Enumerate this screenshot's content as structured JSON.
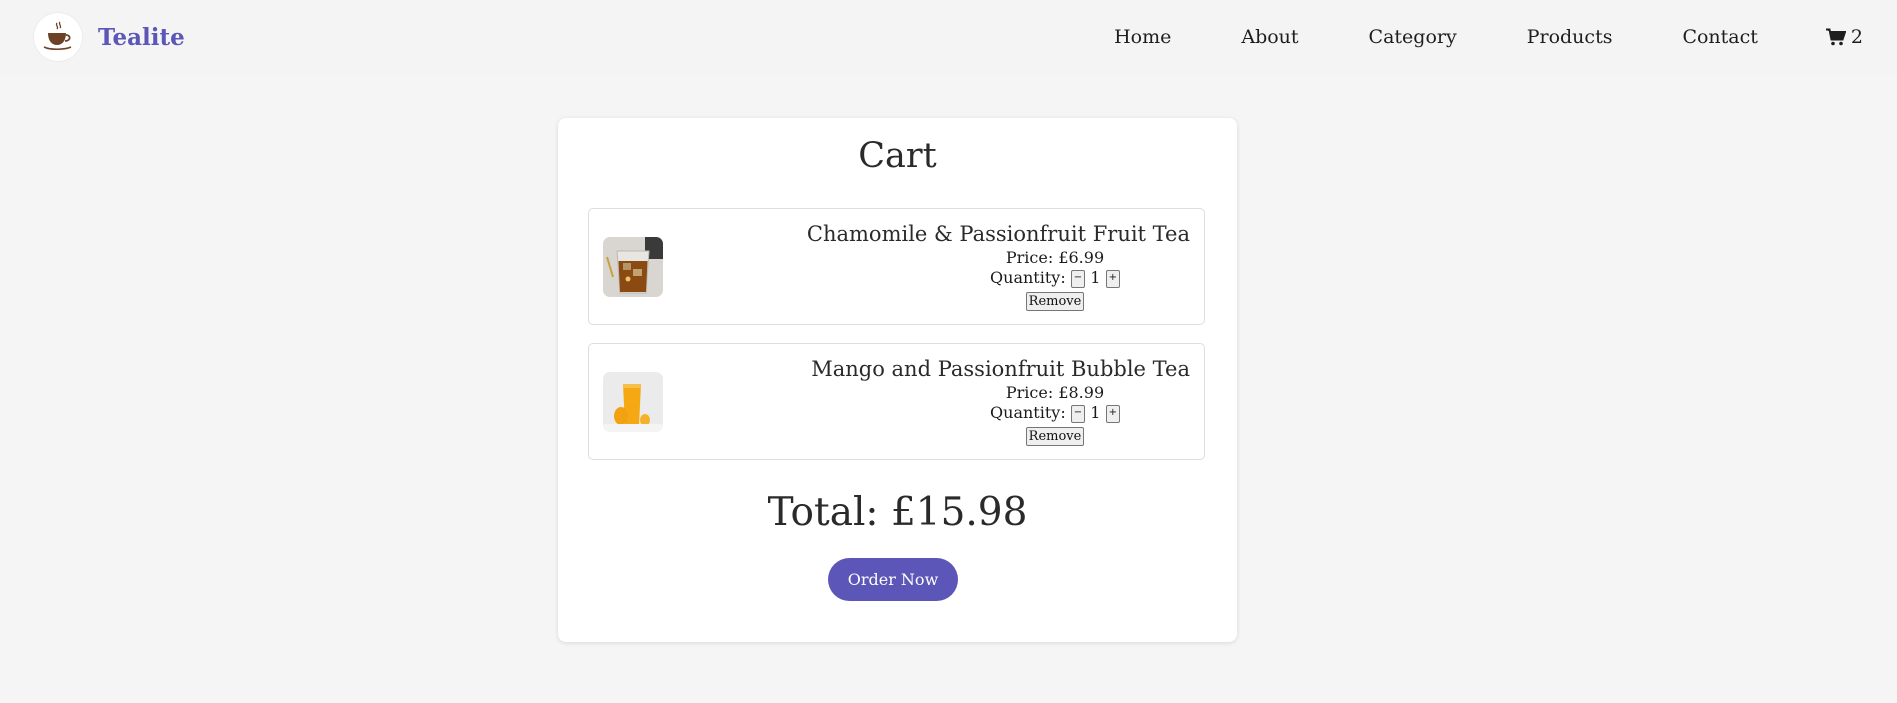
{
  "header": {
    "brand": "Tealite",
    "nav": [
      "Home",
      "About",
      "Category",
      "Products",
      "Contact"
    ],
    "cart_count": "2"
  },
  "cart": {
    "title": "Cart",
    "items": [
      {
        "name": "Chamomile & Passionfruit Fruit Tea",
        "price_label": "Price: £6.99",
        "quantity_label": "Quantity:",
        "quantity": "1",
        "decrement": "−",
        "increment": "+",
        "remove_label": "Remove"
      },
      {
        "name": "Mango and Passionfruit Bubble Tea",
        "price_label": "Price: £8.99",
        "quantity_label": "Quantity:",
        "quantity": "1",
        "decrement": "−",
        "increment": "+",
        "remove_label": "Remove"
      }
    ],
    "total": "Total: £15.98",
    "order_label": "Order Now"
  },
  "colors": {
    "accent": "#5b56b7",
    "background": "#f5f5f5"
  },
  "icons": {
    "logo": "teacup-icon",
    "cart": "shopping-cart-icon"
  }
}
